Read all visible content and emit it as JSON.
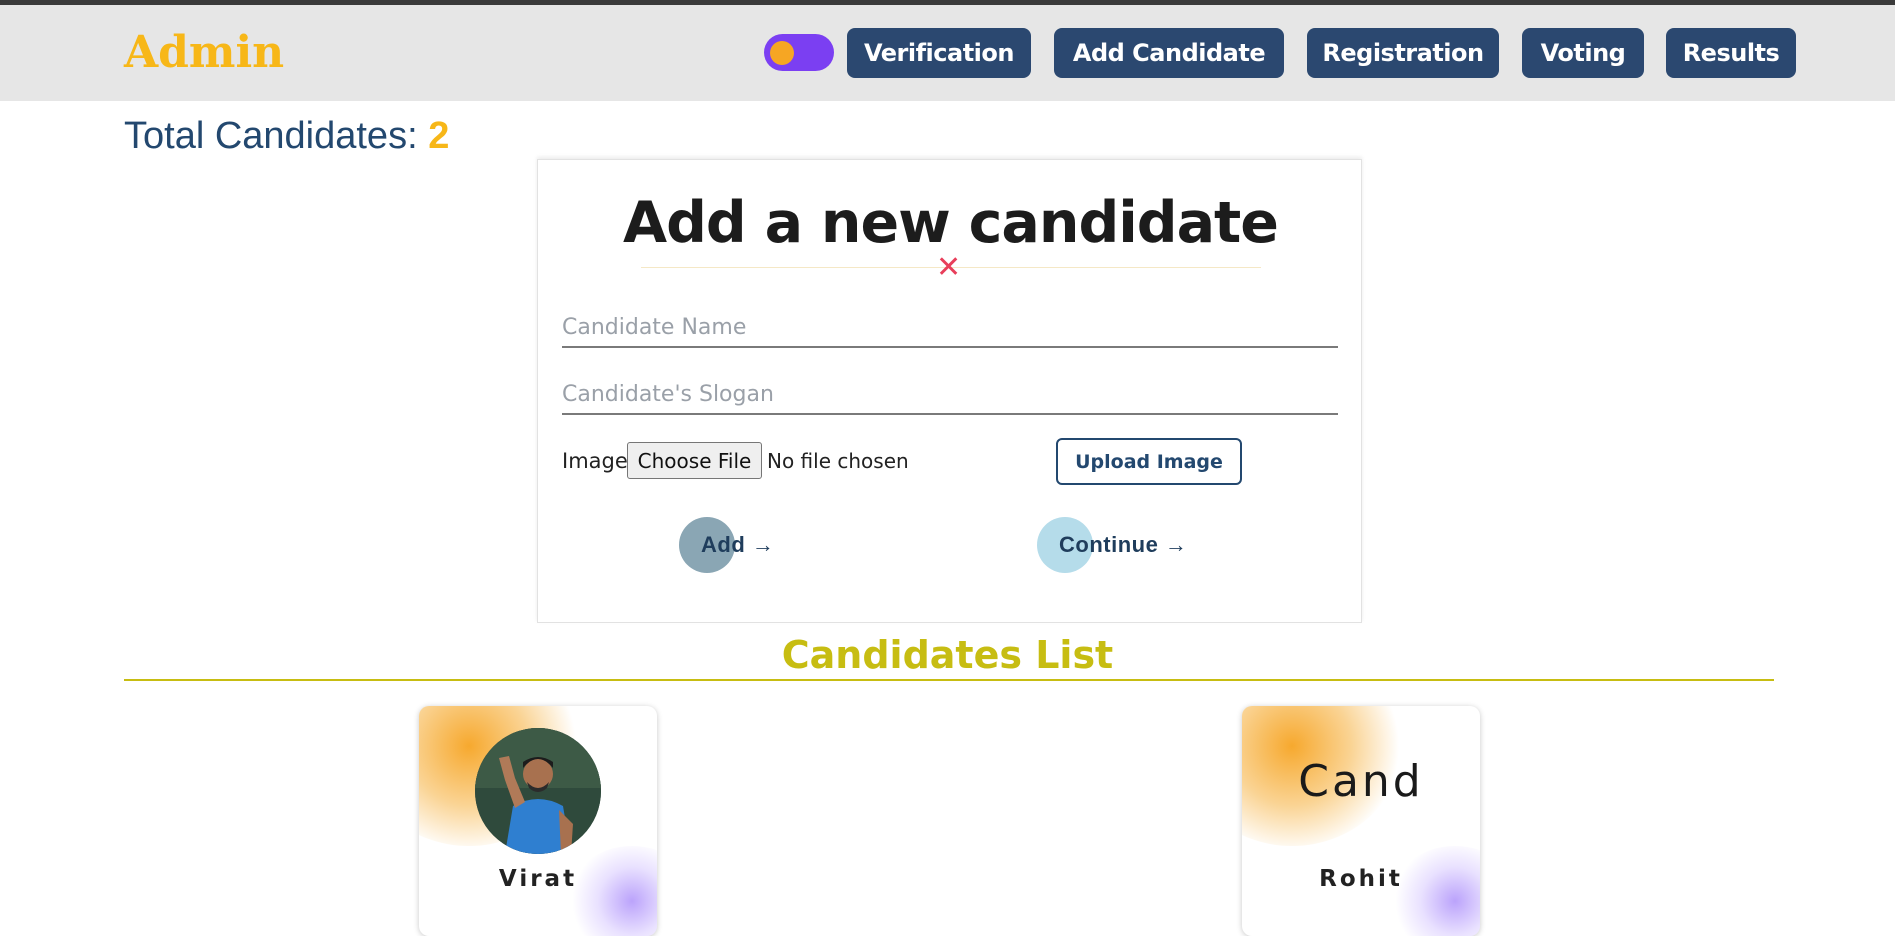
{
  "navbar": {
    "brand": "Admin",
    "buttons": [
      "Verification",
      "Add Candidate",
      "Registration",
      "Voting",
      "Results"
    ]
  },
  "summary": {
    "label": "Total Candidates: ",
    "count": "2"
  },
  "form": {
    "title": "Add a new candidate",
    "close_symbol": "✕",
    "name_placeholder": "Candidate Name",
    "slogan_placeholder": "Candidate's Slogan",
    "image_label": "Image",
    "file_button": "Choose File",
    "file_status": "No file chosen",
    "upload_label": "Upload Image",
    "add_label": "Add →",
    "continue_label": "Continue →"
  },
  "candidates_section": {
    "title": "Candidates List",
    "items": [
      {
        "name": "Virat",
        "image_alt": ""
      },
      {
        "name": "Rohit",
        "image_alt": "Cand"
      }
    ]
  },
  "colors": {
    "brand": "#f7b718",
    "nav_button": "#2b4870",
    "toggle": "#7b3ff2",
    "section_title": "#c7bd12",
    "close": "#e83e5a"
  }
}
